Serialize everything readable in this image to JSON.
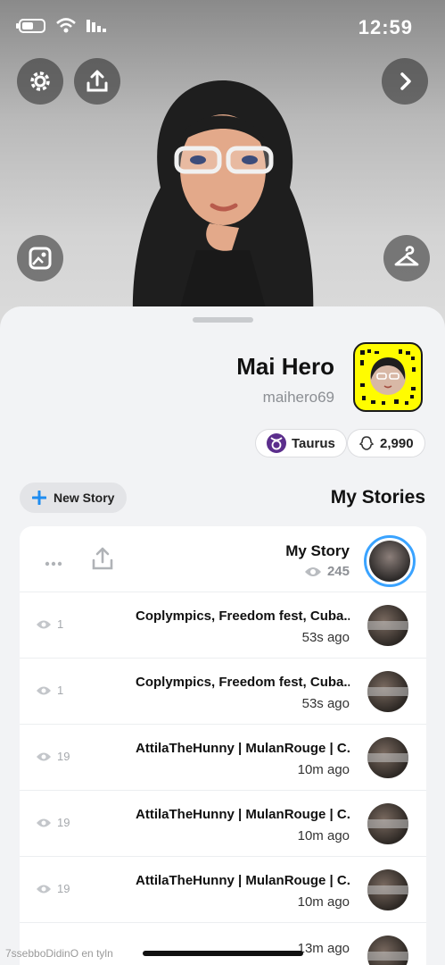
{
  "status_bar": {
    "time": "12:59"
  },
  "profile": {
    "display_name": "Mai Hero",
    "username": "maihero69",
    "score": "2,990",
    "zodiac": "Taurus"
  },
  "stories": {
    "section_title": "My Stories",
    "new_story_label": "New Story",
    "my_story": {
      "title": "My Story",
      "views": "245"
    },
    "items": [
      {
        "title": "Coplympics, Freedom fest, Cuba...",
        "time": "53s ago",
        "views": "1"
      },
      {
        "title": "Coplympics, Freedom fest, Cuba...",
        "time": "53s ago",
        "views": "1"
      },
      {
        "title": "AttilaTheHunny | MulanRouge | C...",
        "time": "10m ago",
        "views": "19"
      },
      {
        "title": "AttilaTheHunny | MulanRouge | C...",
        "time": "10m ago",
        "views": "19"
      },
      {
        "title": "AttilaTheHunny | MulanRouge | C...",
        "time": "10m ago",
        "views": "19"
      },
      {
        "title": "",
        "time": "13m ago",
        "views": ""
      }
    ]
  },
  "watermark": "7ssebboDidinO en tyln",
  "colors": {
    "snapcode_yellow": "#fffc00",
    "story_ring": "#3aa3ff",
    "zodiac_badge": "#5b2e8c"
  },
  "icons": [
    "settings-icon",
    "share-icon",
    "chevron-right-icon",
    "gallery-icon",
    "hanger-icon",
    "snapcode",
    "ghost-icon",
    "taurus-icon",
    "plus-icon",
    "upload-icon",
    "more-icon",
    "eye-icon"
  ]
}
